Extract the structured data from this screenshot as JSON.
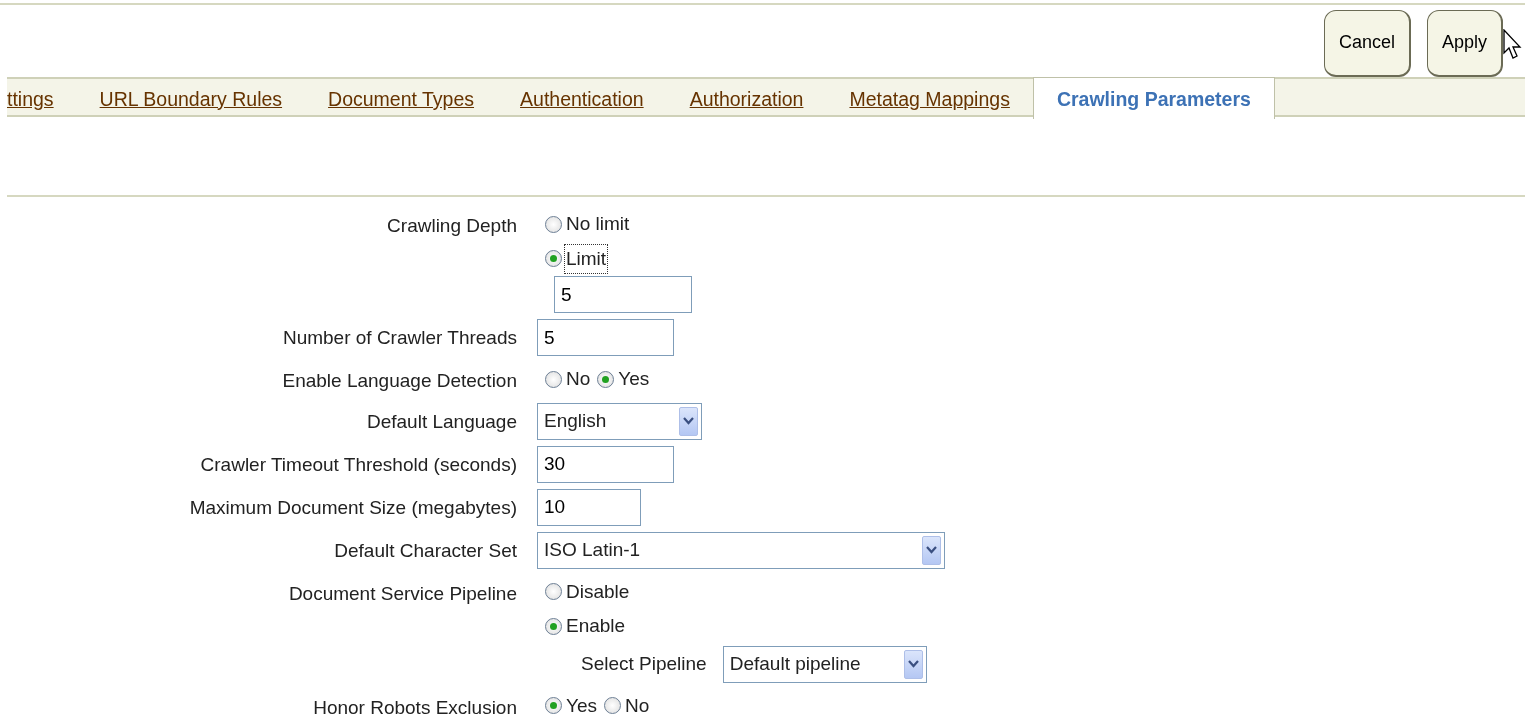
{
  "buttons": [
    {
      "label": "Cancel"
    },
    {
      "label": "Apply"
    }
  ],
  "tabs": [
    {
      "label": "ttings",
      "selected": false
    },
    {
      "label": "URL Boundary Rules",
      "selected": false
    },
    {
      "label": "Document Types",
      "selected": false
    },
    {
      "label": "Authentication",
      "selected": false
    },
    {
      "label": "Authorization",
      "selected": false
    },
    {
      "label": "Metatag Mappings",
      "selected": false
    },
    {
      "label": "Crawling Parameters",
      "selected": true
    }
  ],
  "fields": [
    {
      "kind": "radio-stack",
      "label": "Crawling Depth",
      "options": [
        {
          "label": "No limit",
          "selected": false,
          "focused": false
        },
        {
          "label": "Limit",
          "selected": true,
          "focused": true
        }
      ],
      "value": "5"
    },
    {
      "kind": "text",
      "label": "Number of Crawler Threads",
      "value": "5"
    },
    {
      "kind": "radio-inline",
      "label": "Enable Language Detection",
      "options": [
        {
          "label": "No",
          "selected": false
        },
        {
          "label": "Yes",
          "selected": true
        }
      ]
    },
    {
      "kind": "select",
      "label": "Default Language",
      "value": "English"
    },
    {
      "kind": "text",
      "label": "Crawler Timeout Threshold (seconds)",
      "value": "30"
    },
    {
      "kind": "text",
      "label": "Maximum Document Size (megabytes)",
      "value": "10"
    },
    {
      "kind": "select",
      "label": "Default Character Set",
      "value": "ISO Latin-1"
    },
    {
      "kind": "radio-stack",
      "label": "Document Service Pipeline",
      "options": [
        {
          "label": "Disable",
          "selected": false,
          "focused": false
        },
        {
          "label": "Enable",
          "selected": true,
          "focused": false
        }
      ],
      "sub": {
        "label": "Select Pipeline",
        "value": "Default pipeline"
      }
    },
    {
      "kind": "radio-inline",
      "label": "Honor Robots Exclusion",
      "options": [
        {
          "label": "Yes",
          "selected": true
        },
        {
          "label": "No",
          "selected": false
        }
      ]
    }
  ]
}
